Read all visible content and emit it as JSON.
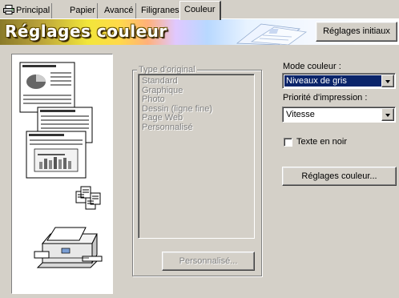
{
  "tabs": [
    {
      "label": "Principal"
    },
    {
      "label": "Papier"
    },
    {
      "label": "Avancé"
    },
    {
      "label": "Filigranes"
    },
    {
      "label": "Couleur"
    }
  ],
  "banner": {
    "title": "Réglages couleur",
    "initial_button": "Réglages initiaux"
  },
  "original_type": {
    "group_label": "Type d'original",
    "items": [
      "Standard",
      "Graphique",
      "Photo",
      "Dessin (ligne fine)",
      "Page Web",
      "Personnalisé"
    ],
    "custom_button": "Personnalisé..."
  },
  "color_mode": {
    "label": "Mode couleur :",
    "value": "Niveaux de gris"
  },
  "print_priority": {
    "label": "Priorité d'impression :",
    "value": "Vitesse"
  },
  "black_text": {
    "label": "Texte en noir",
    "checked": false
  },
  "color_settings_button": "Réglages couleur...",
  "colors": {
    "selection": "#0a246a",
    "face": "#d4d0c8"
  }
}
